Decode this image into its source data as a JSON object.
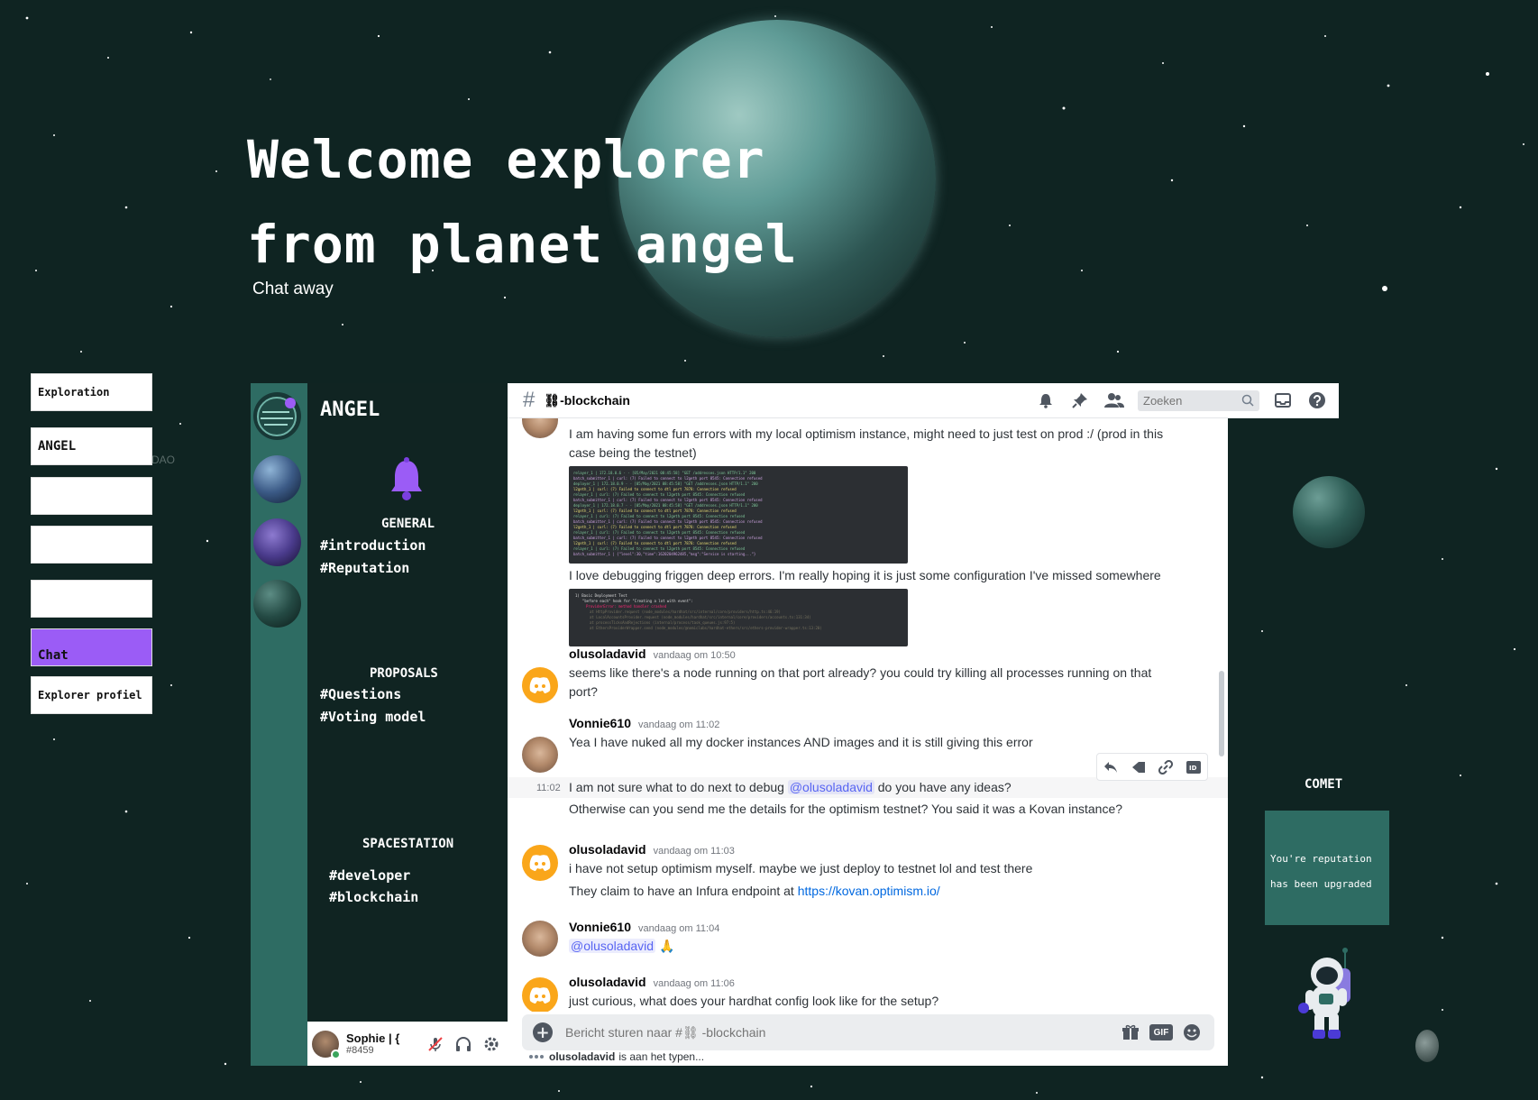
{
  "hero": {
    "title_line1": "Welcome explorer",
    "title_line2": "from planet angel",
    "subtitle": "Chat away"
  },
  "nav": {
    "items": [
      {
        "label": "Exploration"
      },
      {
        "label": "ANGEL"
      },
      {
        "label": ""
      },
      {
        "label": ""
      },
      {
        "label": ""
      },
      {
        "label": "Chat",
        "active": true
      },
      {
        "label": "Explorer profiel"
      }
    ],
    "ghost_text": "DAO"
  },
  "server": {
    "name": "ANGEL",
    "categories": [
      {
        "label": "GENERAL",
        "channels": [
          "#introduction",
          "#Reputation"
        ]
      },
      {
        "label": "PROPOSALS",
        "channels": [
          "#Questions",
          "#Voting model"
        ]
      },
      {
        "label": "SPACESTATION",
        "channels": [
          "#developer",
          "#blockchain"
        ]
      }
    ],
    "user": {
      "name": "Sophie | {",
      "tag": "#8459"
    }
  },
  "chat": {
    "channel_title": "⛓-blockchain",
    "search_placeholder": "Zoeken",
    "messages": [
      {
        "text": "I am having some fun errors with my local optimism instance, might need to just test on prod :/ (prod in this case being the testnet)"
      },
      {
        "text": "I love debugging friggen deep errors. I'm really hoping it is just some configuration I've missed somewhere"
      },
      {
        "author": "olusoladavid",
        "time": "vandaag om 10:50",
        "text": "seems like there's a node running on that port already? you could try killing all processes running on that port?"
      },
      {
        "author": "Vonnie610",
        "time": "vandaag om 11:02",
        "text": "Yea I have nuked all my docker instances AND images and it is still giving this error"
      },
      {
        "hover_time": "11:02",
        "text_before": "I am not sure what to do next to debug ",
        "mention": "@olusoladavid",
        "text_after": " do you have any ideas?"
      },
      {
        "text": "Otherwise can you send me the details for the optimism testnet? You said it was a Kovan instance?"
      },
      {
        "author": "olusoladavid",
        "time": "vandaag om 11:03",
        "text": "i have not setup optimism myself. maybe we just deploy to testnet lol and test there"
      },
      {
        "text_before": "They claim to have an Infura endpoint at ",
        "link": "https://kovan.optimism.io/"
      },
      {
        "author": "Vonnie610",
        "time": "vandaag om 11:04",
        "mention": "@olusoladavid",
        "emoji": "🙏"
      },
      {
        "author": "olusoladavid",
        "time": "vandaag om 11:06",
        "text": "just curious, what does your hardhat config look like for the setup?"
      }
    ],
    "composer_placeholder": "Bericht sturen naar #⛓ -blockchain",
    "gif_label": "GIF",
    "typing_user": "olusoladavid",
    "typing_suffix": "is aan het typen..."
  },
  "comet": {
    "label": "COMET",
    "card_line1": "You're reputation",
    "card_line2": "has been upgraded"
  },
  "colors": {
    "accent": "#9b5cf6",
    "teal": "#2e6c63",
    "background": "#0f2422",
    "mention": "#5865f2",
    "discord_orange": "#faa61a"
  }
}
